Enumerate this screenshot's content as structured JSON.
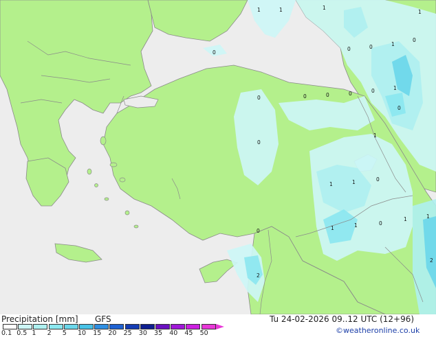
{
  "legend": {
    "title": "Precipitation [mm]",
    "model": "GFS",
    "ticks": [
      "0.1",
      "0.5",
      "1",
      "2",
      "5",
      "10",
      "15",
      "20",
      "25",
      "30",
      "35",
      "40",
      "45",
      "50"
    ],
    "colors": [
      "#ffffff",
      "#cdf6f6",
      "#aef0f0",
      "#8be7ef",
      "#6ad6ea",
      "#48c2e6",
      "#2f8fe2",
      "#1f62d2",
      "#143cb4",
      "#0e1f90",
      "#6a10c0",
      "#a018d8",
      "#cc20e0",
      "#e838d8"
    ]
  },
  "valid_time": "Tu 24-02-2026 09..12 UTC (12+96)",
  "credit": "©weatheronline.co.uk",
  "map_labels": [
    {
      "id": "l1",
      "text": "1"
    },
    {
      "id": "l2",
      "text": "1"
    },
    {
      "id": "l3",
      "text": "1"
    },
    {
      "id": "l4",
      "text": "1"
    },
    {
      "id": "l5",
      "text": "0"
    },
    {
      "id": "l6",
      "text": "0"
    },
    {
      "id": "l7",
      "text": "0"
    },
    {
      "id": "l8",
      "text": "1"
    },
    {
      "id": "l9",
      "text": "0"
    },
    {
      "id": "l10",
      "text": "1"
    },
    {
      "id": "l11",
      "text": "0"
    },
    {
      "id": "l12",
      "text": "0"
    },
    {
      "id": "l13",
      "text": "0"
    },
    {
      "id": "l14",
      "text": "0"
    },
    {
      "id": "l15",
      "text": "0"
    },
    {
      "id": "l16",
      "text": "0"
    },
    {
      "id": "l17",
      "text": "0"
    },
    {
      "id": "l18",
      "text": "1"
    },
    {
      "id": "l19",
      "text": "1"
    },
    {
      "id": "l20",
      "text": "1"
    },
    {
      "id": "l21",
      "text": "0"
    },
    {
      "id": "l22",
      "text": "1"
    },
    {
      "id": "l23",
      "text": "1"
    },
    {
      "id": "l24",
      "text": "0"
    },
    {
      "id": "l25",
      "text": "1"
    },
    {
      "id": "l26",
      "text": "1"
    },
    {
      "id": "l27",
      "text": "0"
    },
    {
      "id": "l28",
      "text": "2"
    },
    {
      "id": "l29",
      "text": "2"
    }
  ],
  "palette": {
    "land": "#b4f08c",
    "sea": "#ededed",
    "coast": "#8a8a8a",
    "precip_light": "#cdf6f6",
    "precip_mid": "#aef0f0",
    "precip_high": "#8be7ef",
    "precip_core": "#6ad6ea"
  }
}
